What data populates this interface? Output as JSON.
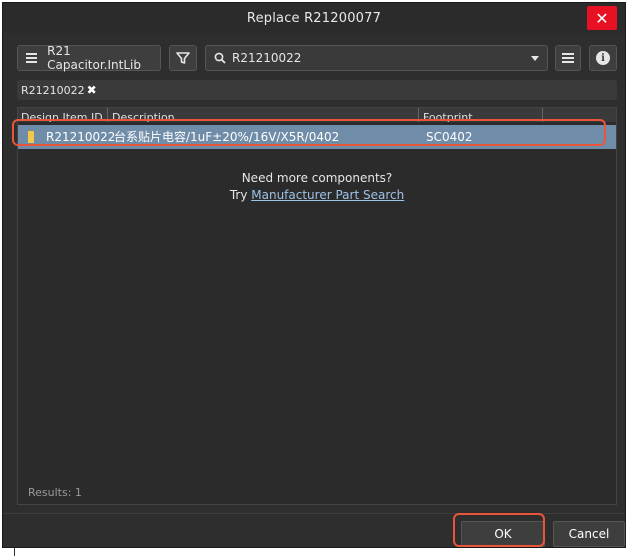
{
  "window": {
    "title": "Replace R21200077",
    "close_glyph": "✕"
  },
  "toolbar": {
    "library_label": "R21 Capacitor.IntLib",
    "search_value": "R21210022",
    "icons": {
      "library": "hamburger-menu-icon",
      "filter": "funnel-filter-icon",
      "search": "magnifier-search-icon",
      "dropdown": "chevron-down-icon",
      "menu": "hamburger-menu-icon",
      "info": "info-icon"
    },
    "info_glyph": "i"
  },
  "filter_chip": {
    "label": "R21210022",
    "remove_glyph": "✖"
  },
  "grid": {
    "columns": [
      "Design Item ID",
      "Description",
      "Footprint"
    ],
    "rows": [
      {
        "design_item_id": "R21210022",
        "description": "台系贴片电容/1uF±20%/16V/X5R/0402",
        "footprint": "SC0402"
      }
    ],
    "empty_line1": "Need more components?",
    "empty_try": "Try",
    "empty_link": "Manufacturer Part Search",
    "results_label": "Results: 1"
  },
  "buttons": {
    "ok": "OK",
    "cancel": "Cancel"
  },
  "colors": {
    "dialog_bg": "#2e2e2e",
    "selected_row": "#6f8ca8",
    "highlight_outline": "#e8553b",
    "close_red": "#e81123",
    "link": "#9fc3e8"
  }
}
